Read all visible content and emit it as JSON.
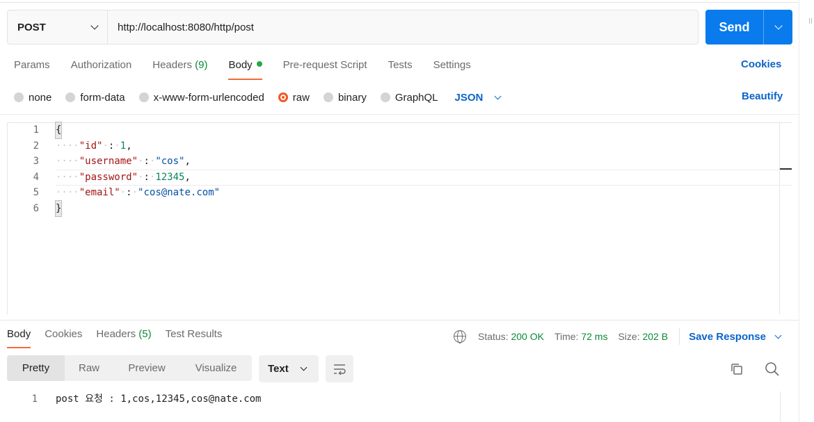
{
  "request": {
    "method": "POST",
    "url": "http://localhost:8080/http/post",
    "send_label": "Send"
  },
  "request_tabs": [
    {
      "label": "Params"
    },
    {
      "label": "Authorization"
    },
    {
      "label": "Headers",
      "count": "(9)"
    },
    {
      "label": "Body",
      "active": true
    },
    {
      "label": "Pre-request Script"
    },
    {
      "label": "Tests"
    },
    {
      "label": "Settings"
    }
  ],
  "cookies_label": "Cookies",
  "body_types": {
    "options": [
      "none",
      "form-data",
      "x-www-form-urlencoded",
      "raw",
      "binary",
      "GraphQL"
    ],
    "selected": "raw",
    "format": "JSON",
    "beautify_label": "Beautify"
  },
  "editor": {
    "lines": [
      {
        "n": "1",
        "text": "{"
      },
      {
        "n": "2",
        "key": "\"id\"",
        "value": "1",
        "value_type": "num"
      },
      {
        "n": "3",
        "key": "\"username\"",
        "value": "\"cos\"",
        "value_type": "str"
      },
      {
        "n": "4",
        "key": "\"password\"",
        "value": "12345",
        "value_type": "num"
      },
      {
        "n": "5",
        "key": "\"email\"",
        "value": "\"cos@nate.com\"",
        "value_type": "str"
      },
      {
        "n": "6",
        "text": "}"
      }
    ]
  },
  "response": {
    "tabs": [
      {
        "label": "Body",
        "active": true
      },
      {
        "label": "Cookies"
      },
      {
        "label": "Headers",
        "count": "(5)"
      },
      {
        "label": "Test Results"
      }
    ],
    "status_label": "Status:",
    "status_value": "200 OK",
    "time_label": "Time:",
    "time_value": "72 ms",
    "size_label": "Size:",
    "size_value": "202 B",
    "save_label": "Save Response",
    "views": [
      "Pretty",
      "Raw",
      "Preview",
      "Visualize"
    ],
    "active_view": "Pretty",
    "text_format": "Text",
    "body_line_number": "1",
    "body_text": "post 요청 : 1,cos,12345,cos@nate.com"
  },
  "colors": {
    "accent_blue": "#097bed",
    "link_blue": "#0b64c9",
    "active_orange": "#f26b3a",
    "success_green": "#0a8a33"
  }
}
